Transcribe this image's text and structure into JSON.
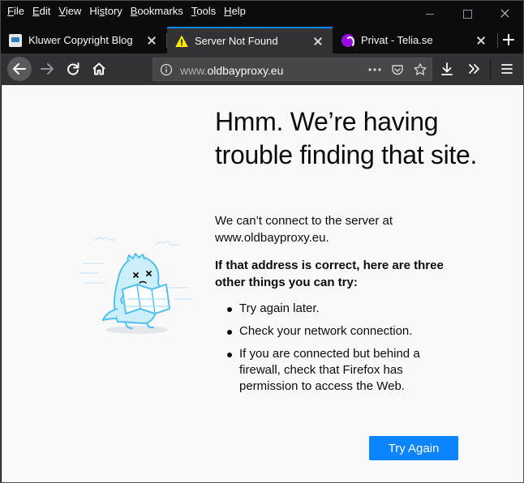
{
  "menubar": {
    "items": [
      {
        "label": "File",
        "mnemonic": "F",
        "rest": "ile"
      },
      {
        "label": "Edit",
        "mnemonic": "E",
        "rest": "dit"
      },
      {
        "label": "View",
        "mnemonic": "V",
        "rest": "iew"
      },
      {
        "label": "History",
        "mnemonic": "s",
        "pre": "Hi",
        "rest": "tory"
      },
      {
        "label": "Bookmarks",
        "mnemonic": "B",
        "rest": "ookmarks"
      },
      {
        "label": "Tools",
        "mnemonic": "T",
        "rest": "ools"
      },
      {
        "label": "Help",
        "mnemonic": "H",
        "rest": "elp"
      }
    ]
  },
  "tabs": [
    {
      "label": "Kluwer Copyright Blog",
      "icon": "kluwer-favicon"
    },
    {
      "label": "Server Not Found",
      "icon": "warning-icon",
      "active": true
    },
    {
      "label": "Privat - Telia.se",
      "icon": "telia-favicon"
    }
  ],
  "urlbar": {
    "prefix": "www.",
    "domain": "oldbayproxy.eu"
  },
  "error": {
    "title": "Hmm. We’re having trouble finding that site.",
    "description": "We can’t connect to the server at www.oldbayproxy.eu.",
    "subhead": "If that address is correct, here are three other things you can try:",
    "tips": [
      "Try again later.",
      "Check your network connection.",
      "If you are connected but behind a firewall, check that Firefox has permission to access the Web."
    ],
    "button": "Try Again"
  },
  "colors": {
    "accent": "#0a84ff",
    "toolbar": "#323234",
    "tabstrip": "#0c0c0d",
    "content_bg": "#f9f9fa",
    "warning": "#ffe900"
  }
}
